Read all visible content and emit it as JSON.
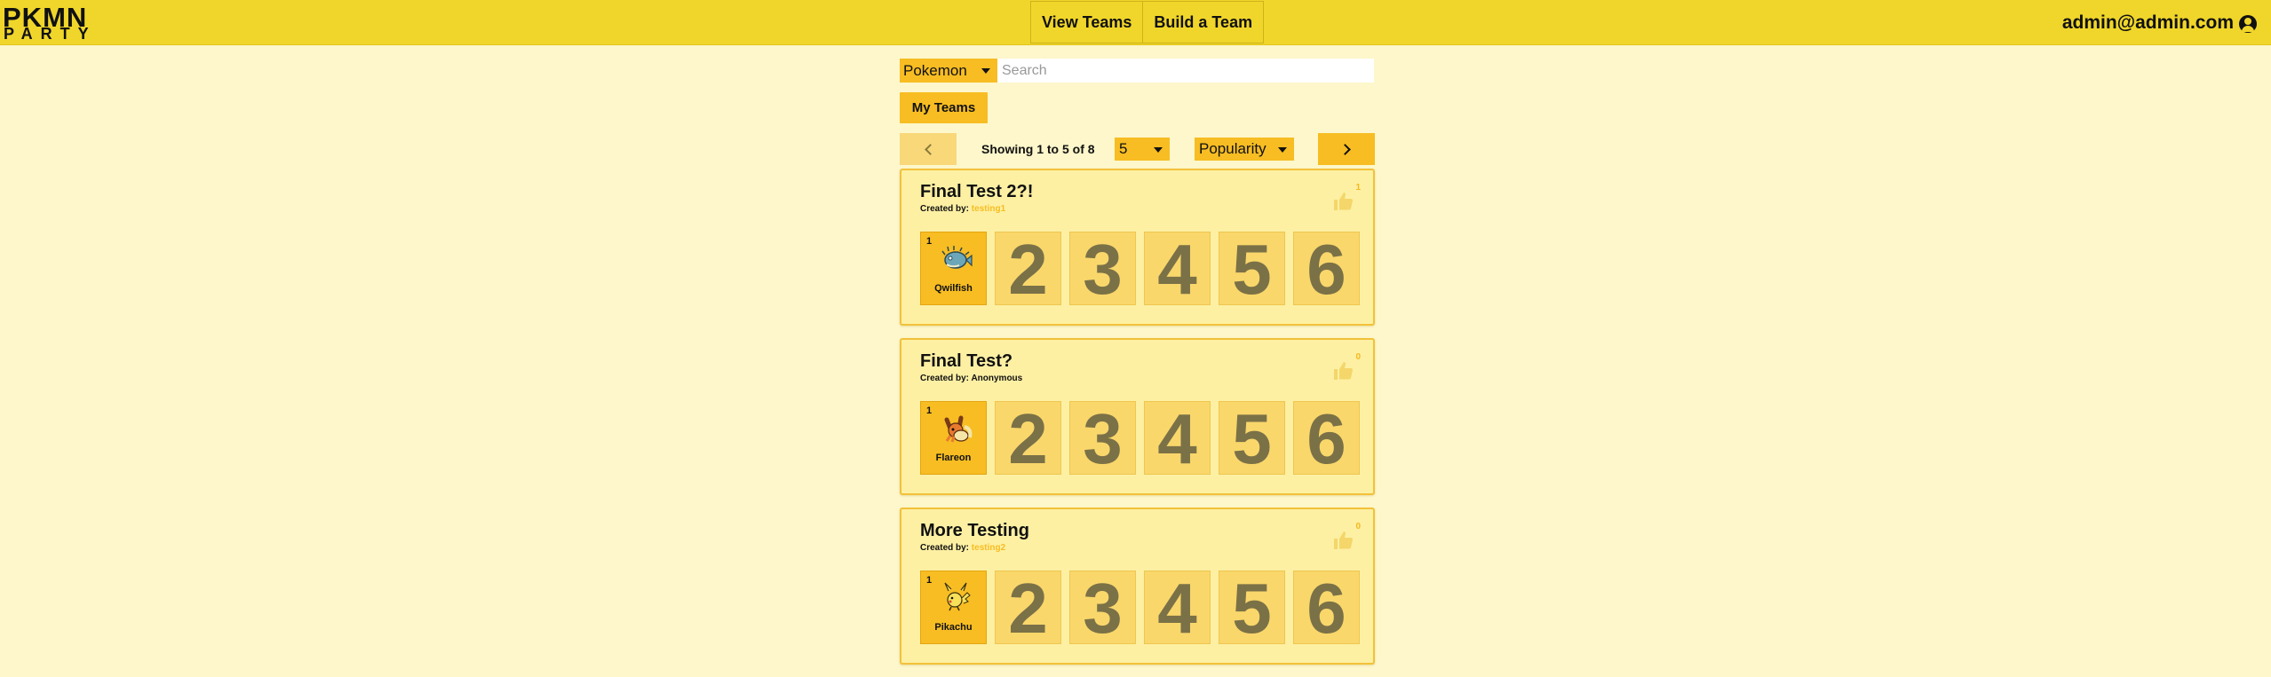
{
  "header": {
    "logo_line1": "PKMN",
    "logo_line2": "PARTY",
    "nav": [
      "View Teams",
      "Build a Team"
    ],
    "user_email": "admin@admin.com"
  },
  "search": {
    "filter_value": "Pokemon",
    "placeholder": "Search"
  },
  "my_teams_label": "My Teams",
  "pagination": {
    "showing_text": "Showing 1 to 5 of 8",
    "per_page": "5",
    "sort": "Popularity"
  },
  "colors": {
    "header": "#f0d62a",
    "background": "#fdf7cb",
    "accent": "#f7bd22",
    "card": "#fdf0a3",
    "link": "#f7bd22"
  },
  "teams": [
    {
      "title": "Final Test 2?!",
      "created_by_label": "Created by:",
      "creator": "testing1",
      "creator_is_link": true,
      "likes": "1",
      "slot1_num": "1",
      "slot1_pokemon": "Qwilfish",
      "slot1_icon": "qwilfish-sprite",
      "empty_slots": [
        "2",
        "3",
        "4",
        "5",
        "6"
      ]
    },
    {
      "title": "Final Test?",
      "created_by_label": "Created by:",
      "creator": "Anonymous",
      "creator_is_link": false,
      "likes": "0",
      "slot1_num": "1",
      "slot1_pokemon": "Flareon",
      "slot1_icon": "flareon-sprite",
      "empty_slots": [
        "2",
        "3",
        "4",
        "5",
        "6"
      ]
    },
    {
      "title": "More Testing",
      "created_by_label": "Created by:",
      "creator": "testing2",
      "creator_is_link": true,
      "likes": "0",
      "slot1_num": "1",
      "slot1_pokemon": "Pikachu",
      "slot1_icon": "pikachu-sprite",
      "empty_slots": [
        "2",
        "3",
        "4",
        "5",
        "6"
      ]
    }
  ]
}
